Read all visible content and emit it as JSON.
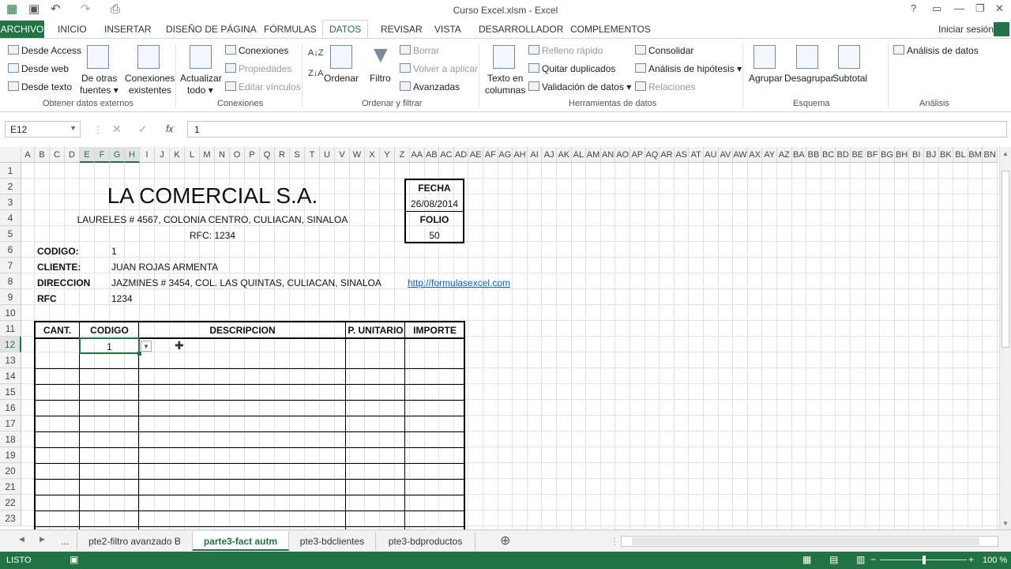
{
  "window": {
    "title": "Curso Excel.xlsm - Excel"
  },
  "ribbon_tabs": [
    "ARCHIVO",
    "INICIO",
    "INSERTAR",
    "DISEÑO DE PÁGINA",
    "FÓRMULAS",
    "DATOS",
    "REVISAR",
    "VISTA",
    "DESARROLLADOR",
    "COMPLEMENTOS"
  ],
  "account": "Iniciar sesión",
  "ribbon": {
    "desde_access": "Desde Access",
    "desde_web": "Desde web",
    "desde_texto": "Desde texto",
    "de_otras_1": "De otras",
    "de_otras_2": "fuentes",
    "conexiones_existentes_1": "Conexiones",
    "conexiones_existentes_2": "existentes",
    "actualizar_1": "Actualizar",
    "actualizar_2": "todo",
    "conexiones": "Conexiones",
    "propiedades": "Propiedades",
    "editar_vinculos": "Editar vínculos",
    "ordenar": "Ordenar",
    "filtro": "Filtro",
    "borrar": "Borrar",
    "volver_aplicar": "Volver a aplicar",
    "avanzadas": "Avanzadas",
    "texto_columnas_1": "Texto en",
    "texto_columnas_2": "columnas",
    "relleno_rapido": "Relleno rápido",
    "quitar_duplicados": "Quitar duplicados",
    "validacion": "Validación de datos",
    "consolidar": "Consolidar",
    "analisis_hipotesis": "Análisis de hipótesis",
    "relaciones": "Relaciones",
    "agrupar": "Agrupar",
    "desagrupar": "Desagrupar",
    "subtotal": "Subtotal",
    "analisis_datos": "Análisis de datos",
    "groups": {
      "obtener": "Obtener datos externos",
      "conexiones": "Conexiones",
      "ordenar_filtrar": "Ordenar y filtrar",
      "herramientas": "Herramientas de datos",
      "esquema": "Esquema",
      "analisis": "Análisis"
    }
  },
  "formula_bar": {
    "name_box": "E12",
    "fx": "fx",
    "value": "1"
  },
  "columns": [
    "A",
    "B",
    "C",
    "D",
    "E",
    "F",
    "G",
    "H",
    "I",
    "J",
    "K",
    "L",
    "M",
    "N",
    "O",
    "P",
    "Q",
    "R",
    "S",
    "T",
    "U",
    "V",
    "W",
    "X",
    "Y",
    "Z",
    "AA",
    "AB",
    "AC",
    "AD",
    "AE",
    "AF",
    "AG",
    "AH",
    "AI",
    "AJ",
    "AK",
    "AL",
    "AM",
    "AN",
    "AO",
    "AP",
    "AQ",
    "AR",
    "AS",
    "AT",
    "AU",
    "AV",
    "AW",
    "AX",
    "AY",
    "AZ",
    "BA",
    "BB",
    "BC",
    "BD",
    "BE",
    "BF",
    "BG",
    "BH",
    "BI",
    "BJ",
    "BK",
    "BL",
    "BM",
    "BN"
  ],
  "rows": [
    "1",
    "2",
    "3",
    "4",
    "5",
    "6",
    "7",
    "8",
    "9",
    "10",
    "11",
    "12",
    "13",
    "14",
    "15",
    "16",
    "17",
    "18",
    "19",
    "20",
    "21",
    "22",
    "23"
  ],
  "sheet": {
    "company": "LA COMERCIAL S.A.",
    "address": "LAURELES # 4567, COLONIA CENTRO, CULIACAN, SINALOA",
    "rfc_line": "RFC: 1234",
    "fecha_label": "FECHA",
    "fecha_value": "26/08/2014",
    "folio_label": "FOLIO",
    "folio_value": "50",
    "codigo_label": "CODIGO:",
    "codigo_value": "1",
    "cliente_label": "CLIENTE:",
    "cliente_value": "JUAN ROJAS ARMENTA",
    "direccion_label": "DIRECCION",
    "direccion_value": "JAZMINES # 3454, COL. LAS QUINTAS, CULIACAN, SINALOA",
    "link": "http://formulasexcel.com",
    "rfc_label": "RFC",
    "rfc_value": "1234",
    "table_headers": [
      "CANT.",
      "CODIGO",
      "DESCRIPCION",
      "P. UNITARIO",
      "IMPORTE"
    ],
    "row12_codigo": "1"
  },
  "sheet_tabs": {
    "more": "...",
    "tabs": [
      "pte2-filtro avanzado B",
      "parte3-fact autm",
      "pte3-bdclientes",
      "pte3-bdproductos"
    ],
    "active": "parte3-fact autm"
  },
  "status": {
    "mode": "LISTO",
    "zoom": "100 %"
  }
}
